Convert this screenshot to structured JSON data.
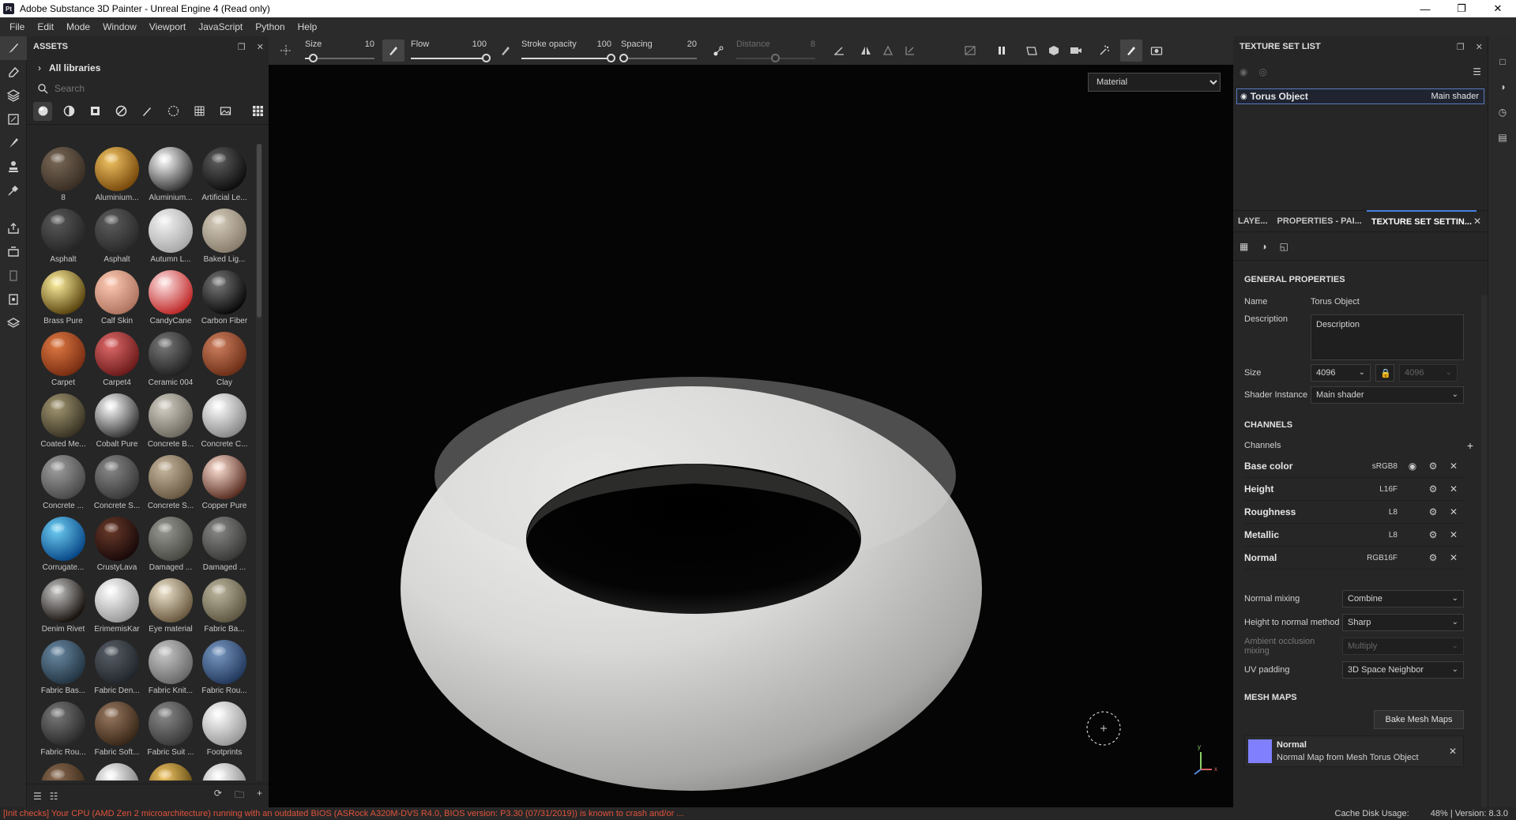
{
  "window": {
    "title": "Adobe Substance 3D Painter - Unreal Engine 4 (Read only)",
    "app_icon": "Pt"
  },
  "menu": [
    "File",
    "Edit",
    "Mode",
    "Window",
    "Viewport",
    "JavaScript",
    "Python",
    "Help"
  ],
  "assets": {
    "title": "ASSETS",
    "library": "All libraries",
    "search_placeholder": "Search",
    "items": [
      {
        "name": "8",
        "colors": [
          "#7a6a58",
          "#3a2e24"
        ]
      },
      {
        "name": "Aluminium...",
        "colors": [
          "#f2c565",
          "#7a4b0c"
        ]
      },
      {
        "name": "Aluminium...",
        "colors": [
          "#ffffff",
          "#3a3a3a"
        ]
      },
      {
        "name": "Artificial Le...",
        "colors": [
          "#606060",
          "#0e0e0e"
        ]
      },
      {
        "name": "Asphalt",
        "colors": [
          "#5a5a5a",
          "#262626"
        ]
      },
      {
        "name": "Asphalt",
        "colors": [
          "#5e5e5e",
          "#2a2a2a"
        ]
      },
      {
        "name": "Autumn L...",
        "colors": [
          "#f4f4f4",
          "#a9a9a9"
        ]
      },
      {
        "name": "Baked Lig...",
        "colors": [
          "#d7cdbc",
          "#8a7f6e"
        ]
      },
      {
        "name": "Brass Pure",
        "colors": [
          "#fff1a0",
          "#5c4710"
        ]
      },
      {
        "name": "Calf Skin",
        "colors": [
          "#ffcbb4",
          "#b07560"
        ]
      },
      {
        "name": "CandyCane",
        "colors": [
          "#ffe6e6",
          "#c02a2a"
        ]
      },
      {
        "name": "Carbon Fiber",
        "colors": [
          "#7a7a7a",
          "#0a0a0a"
        ]
      },
      {
        "name": "Carpet",
        "colors": [
          "#e07a44",
          "#7a2e12"
        ]
      },
      {
        "name": "Carpet4",
        "colors": [
          "#e06a6a",
          "#6e1c1c"
        ]
      },
      {
        "name": "Ceramic 004",
        "colors": [
          "#7a7a7a",
          "#222"
        ]
      },
      {
        "name": "Clay",
        "colors": [
          "#d08160",
          "#6e3018"
        ]
      },
      {
        "name": "Coated Me...",
        "colors": [
          "#a59a74",
          "#3a3424"
        ]
      },
      {
        "name": "Cobalt Pure",
        "colors": [
          "#ffffff",
          "#3a3a3a"
        ]
      },
      {
        "name": "Concrete B...",
        "colors": [
          "#d6d2c8",
          "#6e6a60"
        ]
      },
      {
        "name": "Concrete C...",
        "colors": [
          "#ffffff",
          "#8a8a8a"
        ]
      },
      {
        "name": "Concrete ...",
        "colors": [
          "#a0a0a0",
          "#4a4a4a"
        ]
      },
      {
        "name": "Concrete S...",
        "colors": [
          "#8a8a8a",
          "#3a3a3a"
        ]
      },
      {
        "name": "Concrete S...",
        "colors": [
          "#c8b8a0",
          "#6a5a44"
        ]
      },
      {
        "name": "Copper Pure",
        "colors": [
          "#ffe2d6",
          "#5c3024"
        ]
      },
      {
        "name": "Corrugate...",
        "colors": [
          "#6fd0f4",
          "#0a4a8a"
        ]
      },
      {
        "name": "CrustyLava",
        "colors": [
          "#6a3a2a",
          "#1a0a0a"
        ]
      },
      {
        "name": "Damaged ...",
        "colors": [
          "#9a9a94",
          "#4a4a44"
        ]
      },
      {
        "name": "Damaged ...",
        "colors": [
          "#8a8a88",
          "#3a3a38"
        ]
      },
      {
        "name": "Denim Rivet",
        "colors": [
          "#c8c8c8",
          "#1a1410"
        ]
      },
      {
        "name": "ErimemisKar",
        "colors": [
          "#ffffff",
          "#9a9a9a"
        ]
      },
      {
        "name": "Eye material",
        "colors": [
          "#f0e6d0",
          "#6a5a40"
        ]
      },
      {
        "name": "Fabric Ba...",
        "colors": [
          "#bfb8a0",
          "#5e5844"
        ]
      },
      {
        "name": "Fabric Bas...",
        "colors": [
          "#6a8aa4",
          "#243644"
        ]
      },
      {
        "name": "Fabric Den...",
        "colors": [
          "#5a6068",
          "#22262c"
        ]
      },
      {
        "name": "Fabric Knit...",
        "colors": [
          "#c8c8c8",
          "#6a6a6a"
        ]
      },
      {
        "name": "Fabric Rou...",
        "colors": [
          "#7a9ac4",
          "#243a5e"
        ]
      },
      {
        "name": "Fabric Rou...",
        "colors": [
          "#7a7a7a",
          "#2a2a2a"
        ]
      },
      {
        "name": "Fabric Soft...",
        "colors": [
          "#9a7a62",
          "#3a2818"
        ]
      },
      {
        "name": "Fabric Suit ...",
        "colors": [
          "#8a8a8a",
          "#3a3a3a"
        ]
      },
      {
        "name": "Footprints",
        "colors": [
          "#ffffff",
          "#9a9a9a"
        ]
      },
      {
        "name": "",
        "colors": [
          "#8a6a50",
          "#3a2a1a"
        ]
      },
      {
        "name": "",
        "colors": [
          "#ffffff",
          "#7a7a7a"
        ]
      },
      {
        "name": "",
        "colors": [
          "#f2c565",
          "#5c4710"
        ]
      },
      {
        "name": "",
        "colors": [
          "#ffffff",
          "#8a8a8a"
        ]
      }
    ]
  },
  "toolbar": {
    "size_label": "Size",
    "size_value": "10",
    "size_frac": 0.12,
    "flow_label": "Flow",
    "flow_value": "100",
    "flow_frac": 1.0,
    "opacity_label": "Stroke opacity",
    "opacity_value": "100",
    "opacity_frac": 1.0,
    "spacing_label": "Spacing",
    "spacing_value": "20",
    "spacing_frac": 0.04,
    "distance_label": "Distance",
    "distance_value": "8",
    "distance_frac": 0.5
  },
  "viewport": {
    "mode": "Material",
    "mode_options": [
      "Material"
    ]
  },
  "texture_set_list": {
    "title": "TEXTURE SET LIST",
    "object": "Torus Object",
    "shader": "Main shader"
  },
  "tabs": [
    "LAYE...",
    "PROPERTIES - PAI...",
    "TEXTURE SET SETTIN..."
  ],
  "general": {
    "title": "GENERAL PROPERTIES",
    "name_label": "Name",
    "name_value": "Torus Object",
    "desc_label": "Description",
    "desc_value": "Description",
    "size_label": "Size",
    "size_value": "4096",
    "size_value2": "4096",
    "shader_label": "Shader Instance",
    "shader_value": "Main shader"
  },
  "channels": {
    "title": "CHANNELS",
    "label": "Channels",
    "rows": [
      {
        "name": "Base color",
        "format": "sRGB8"
      },
      {
        "name": "Height",
        "format": "L16F"
      },
      {
        "name": "Roughness",
        "format": "L8"
      },
      {
        "name": "Metallic",
        "format": "L8"
      },
      {
        "name": "Normal",
        "format": "RGB16F"
      }
    ]
  },
  "mixing": {
    "normal_label": "Normal mixing",
    "normal_value": "Combine",
    "h2n_label": "Height to normal method",
    "h2n_value": "Sharp",
    "ao_label": "Ambient occlusion mixing",
    "ao_value": "Multiply",
    "uv_label": "UV padding",
    "uv_value": "3D Space Neighbor"
  },
  "mesh_maps": {
    "title": "MESH MAPS",
    "bake_label": "Bake Mesh Maps",
    "item_name": "Normal",
    "item_desc": "Normal Map from Mesh Torus Object"
  },
  "status": {
    "error": "[Init checks] Your CPU (AMD Zen 2 microarchitecture) running with an outdated BIOS (ASRock A320M-DVS R4.0, BIOS version: P3.30 (07/31/2019)) is known to crash and/or ...",
    "cache": "Cache Disk Usage:",
    "cache_value": "48%",
    "version": "| Version: 8.3.0"
  },
  "colors": {
    "accent": "#4a7fe0",
    "error": "#e0533c",
    "normal_swatch": "#8080ff"
  }
}
